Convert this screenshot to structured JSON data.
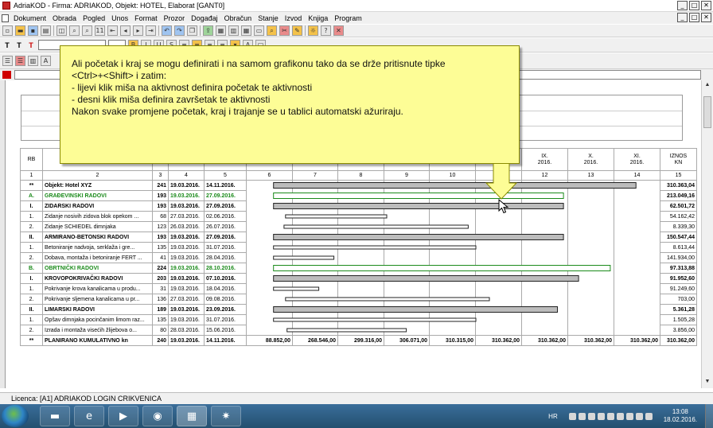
{
  "window": {
    "title": "AdriaKOD - Firma: ADRIAKOD,  Objekt: HOTEL,  Elaborat [GANT0]"
  },
  "menu": [
    "Dokument",
    "Obrada",
    "Pogled",
    "Unos",
    "Format",
    "Prozor",
    "Događaj",
    "Obračun",
    "Stanje",
    "Izvod",
    "Knjiga",
    "Program"
  ],
  "toolbar": {
    "page_value": "11",
    "font_letters": [
      "T",
      "T",
      "T"
    ]
  },
  "tooltip": {
    "lines": [
      "Ali početak i kraj se mogu definirati i na samom grafikonu tako da se drže pritisnute tipke",
      "<Ctrl>+<Shift> i zatim:",
      "- lijevi klik miša na aktivnost definira početak te aktivnosti",
      "- desni klik miša definira završetak te aktivnosti",
      "Nakon svake promjene početak, kraj i trajanje se u tablici automatski ažuriraju."
    ]
  },
  "table": {
    "header": {
      "rb": "RB",
      "m9": "IX.\n2016.",
      "m10": "X.\n2016.",
      "m11": "XI.\n2016.",
      "iznos": "IZNOS\nKN"
    },
    "index": [
      "1",
      "2",
      "3",
      "4",
      "5",
      "6",
      "7",
      "8",
      "9",
      "10",
      "11",
      "12",
      "13",
      "14",
      "15"
    ],
    "rows": [
      {
        "rb": "**",
        "name": "Objekt: Hotel XYZ",
        "dur": "241",
        "start": "19.03.2016.",
        "end": "14.11.2016.",
        "amount": "310.363,04",
        "level": 0,
        "green": false
      },
      {
        "rb": "A.",
        "name": "GRAĐEVINSKI RADOVI",
        "dur": "193",
        "start": "19.03.2016.",
        "end": "27.09.2016.",
        "amount": "213.049,16",
        "level": 0,
        "green": true
      },
      {
        "rb": "I.",
        "name": "ZIDARSKI RADOVI",
        "dur": "193",
        "start": "19.03.2016.",
        "end": "27.09.2016.",
        "amount": "62.501,72",
        "level": 0,
        "green": false
      },
      {
        "rb": "1.",
        "name": "Zidanje nosivih zidova blok opekom ...",
        "dur": "68",
        "start": "27.03.2016.",
        "end": "02.06.2016.",
        "amount": "54.162,42",
        "level": 1,
        "green": false
      },
      {
        "rb": "2.",
        "name": "Zidanje SCHIEDEL dimnjaka",
        "dur": "123",
        "start": "26.03.2016.",
        "end": "26.07.2016.",
        "amount": "8.339,30",
        "level": 1,
        "green": false
      },
      {
        "rb": "II.",
        "name": "ARMIRANO-BETONSKI RADOVI",
        "dur": "193",
        "start": "19.03.2016.",
        "end": "27.09.2016.",
        "amount": "150.547,44",
        "level": 0,
        "green": false
      },
      {
        "rb": "1.",
        "name": "Betoniranje nadvoja, serklaža i gre...",
        "dur": "135",
        "start": "19.03.2016.",
        "end": "31.07.2016.",
        "amount": "8.613,44",
        "level": 1,
        "green": false
      },
      {
        "rb": "2.",
        "name": "Dobava, montaža i betoniranje FERT ...",
        "dur": "41",
        "start": "19.03.2016.",
        "end": "28.04.2016.",
        "amount": "141.934,00",
        "level": 1,
        "green": false
      },
      {
        "rb": "B.",
        "name": "OBRTNIČKI RADOVI",
        "dur": "224",
        "start": "19.03.2016.",
        "end": "28.10.2016.",
        "amount": "97.313,88",
        "level": 0,
        "green": true
      },
      {
        "rb": "I.",
        "name": "KROVOPOKRIVAČKI RADOVI",
        "dur": "203",
        "start": "19.03.2016.",
        "end": "07.10.2016.",
        "amount": "91.952,60",
        "level": 0,
        "green": false
      },
      {
        "rb": "1.",
        "name": "Pokrivanje krova kanalicama u produ...",
        "dur": "31",
        "start": "19.03.2016.",
        "end": "18.04.2016.",
        "amount": "91.249,60",
        "level": 1,
        "green": false
      },
      {
        "rb": "2.",
        "name": "Pokrivanje sljemena kanalicama u pr...",
        "dur": "136",
        "start": "27.03.2016.",
        "end": "09.08.2016.",
        "amount": "703,00",
        "level": 1,
        "green": false
      },
      {
        "rb": "II.",
        "name": "LIMARSKI RADOVI",
        "dur": "189",
        "start": "19.03.2016.",
        "end": "23.09.2016.",
        "amount": "5.361,28",
        "level": 0,
        "green": false
      },
      {
        "rb": "1.",
        "name": "Opšav dimnjaka pocinčanim limom raz...",
        "dur": "135",
        "start": "19.03.2016.",
        "end": "31.07.2016.",
        "amount": "1.505,28",
        "level": 1,
        "green": false
      },
      {
        "rb": "2.",
        "name": "Izrada i montaža visećih žlijebova o...",
        "dur": "80",
        "start": "28.03.2016.",
        "end": "15.06.2016.",
        "amount": "3.856,00",
        "level": 1,
        "green": false
      }
    ],
    "total": {
      "rb": "**",
      "name": "PLANIRANO KUMULATIVNO kn",
      "dur": "240",
      "start": "19.03.2016.",
      "end": "14.11.2016.",
      "months": [
        "88.852,00",
        "268.546,00",
        "299.316,00",
        "306.071,00",
        "310.315,00",
        "310.362,00",
        "310.362,00",
        "310.362,00",
        "310.362,00"
      ],
      "amount": "310.362,00"
    }
  },
  "gantt": {
    "timeline_start": "2016-03-01",
    "timeline_end": "2016-11-30"
  },
  "status": {
    "text": "Licenca: [A1] ADRIAKOD LOGIN CRIKVENICA"
  },
  "taskbar": {
    "lang": "HR",
    "time": "13:08",
    "date": "18.02.2016."
  }
}
